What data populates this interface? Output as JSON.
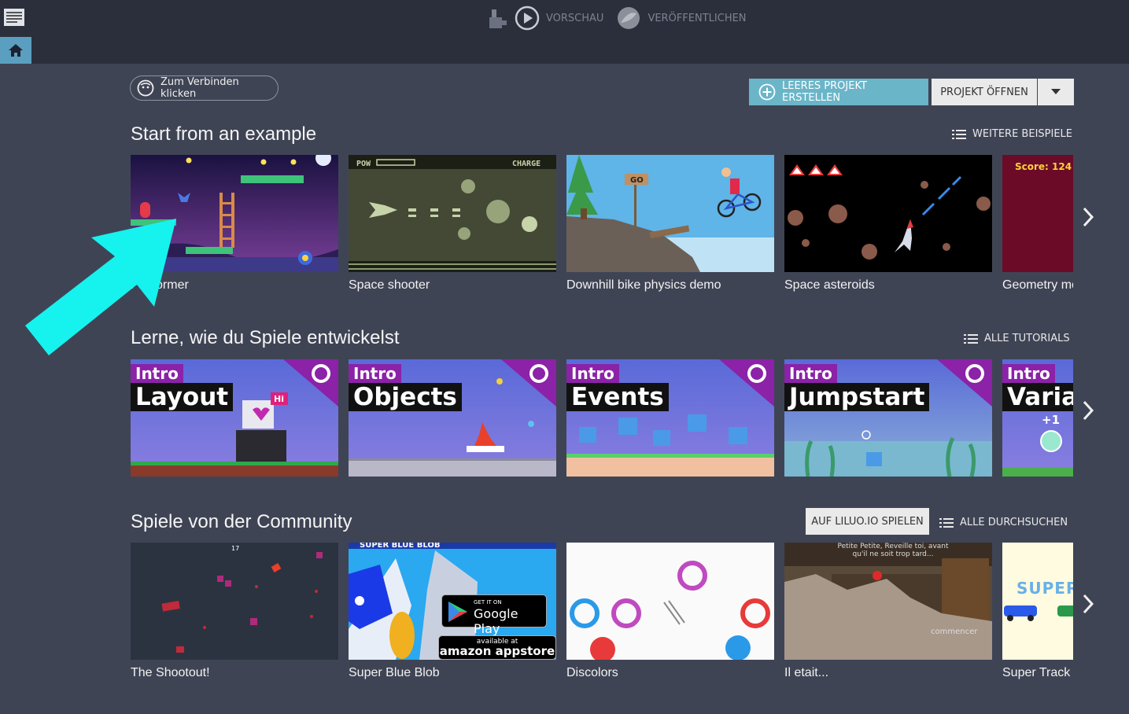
{
  "toolbar": {
    "preview_label": "VORSCHAU",
    "publish_label": "VERÖFFENTLICHEN"
  },
  "header": {
    "connect_label": "Zum Verbinden klicken",
    "new_project_label": "LEERES PROJEKT ERSTELLEN",
    "open_project_label": "PROJEKT ÖFFNEN"
  },
  "examples": {
    "title": "Start from an example",
    "more_label": "WEITERE BEISPIELE",
    "items": [
      {
        "label": "Platformer"
      },
      {
        "label": "Space shooter"
      },
      {
        "label": "Downhill bike physics demo"
      },
      {
        "label": "Space asteroids"
      },
      {
        "label": "Geometry monster",
        "score_text": "Score: 124"
      }
    ],
    "shooter_hud": {
      "left": "POW",
      "right": "CHARGE"
    },
    "bike_sign": "GO"
  },
  "tutorials": {
    "title": "Lerne, wie du Spiele entwickelst",
    "more_label": "ALLE TUTORIALS",
    "intro_label": "Intro",
    "items": [
      {
        "title": "Layout",
        "bubble": "Hi"
      },
      {
        "title": "Objects"
      },
      {
        "title": "Events"
      },
      {
        "title": "Jumpstart"
      },
      {
        "title": "Variables",
        "badge": "+1"
      }
    ]
  },
  "community": {
    "title": "Spiele von der Community",
    "liluo_label": "AUF LILUO.IO SPIELEN",
    "browse_label": "ALLE DURCHSUCHEN",
    "items": [
      {
        "label": "The Shootout!",
        "hud_count": "17"
      },
      {
        "label": "Super Blue Blob",
        "banner": "SUPER BLUE BLOB",
        "gp_small": "GET IT ON",
        "gp_big": "Google Play",
        "amz_small": "available at",
        "amz_big": "amazon appstore"
      },
      {
        "label": "Discolors"
      },
      {
        "label": "Il etait...",
        "caption": "Petite Petite, Reveille toi, avant qu'il ne soit trop tard...",
        "sign": "commencer"
      },
      {
        "label": "Super Track",
        "banner": "SUPER"
      }
    ]
  },
  "colors": {
    "accent": "#6bb5c9",
    "bg": "#3f4455",
    "topbar": "#2b2f3c",
    "intro_purple": "#8b22a8"
  }
}
